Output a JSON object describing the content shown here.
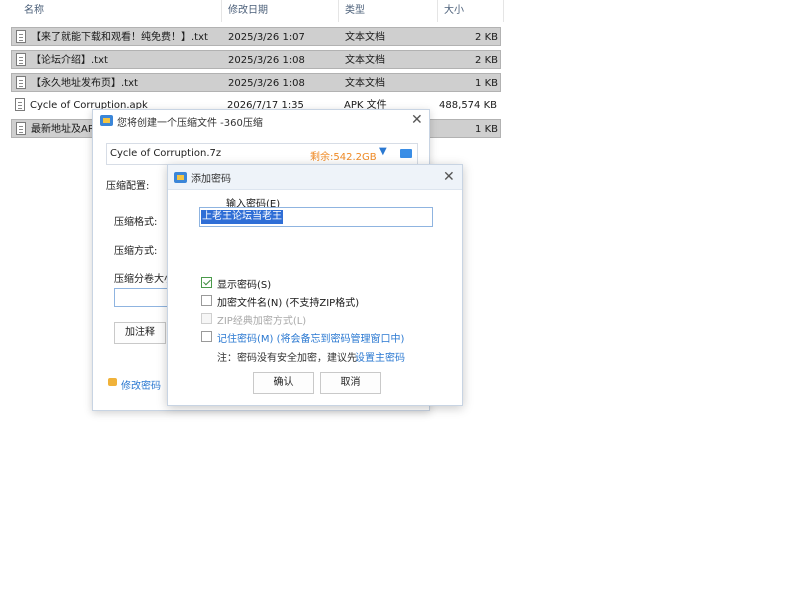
{
  "file_list": {
    "columns": {
      "name": "名称",
      "modified": "修改日期",
      "type": "类型",
      "size": "大小"
    },
    "rows": [
      {
        "name": "【来了就能下载和观看！纯免费！】.txt",
        "modified": "2025/3/26 1:07",
        "type": "文本文档",
        "size": "2 KB",
        "selected": true
      },
      {
        "name": "【论坛介绍】.txt",
        "modified": "2025/3/26 1:08",
        "type": "文本文档",
        "size": "2 KB",
        "selected": true
      },
      {
        "name": "【永久地址发布页】.txt",
        "modified": "2025/3/26 1:08",
        "type": "文本文档",
        "size": "1 KB",
        "selected": true
      },
      {
        "name": "Cycle of Corruption.apk",
        "modified": "2026/7/17 1:35",
        "type": "APK 文件",
        "size": "488,574 KB",
        "selected": false
      },
      {
        "name": "最新地址及AP",
        "modified": "",
        "type": "",
        "size": "1 KB",
        "selected": true
      }
    ]
  },
  "compress_dialog": {
    "title": "您将创建一个压缩文件 -360压缩",
    "filename": "Cycle of Corruption.7z",
    "free_space": "剩余:542.2GB",
    "config_label": "压缩配置:",
    "format_label": "压缩格式:",
    "method_label": "压缩方式:",
    "split_label": "压缩分卷大小",
    "comment_button": "加注释",
    "change_password": "修改密码"
  },
  "password_dialog": {
    "title": "添加密码",
    "enter_label": "输入密码(E)",
    "password_value": "上老王论坛当老王",
    "show_password": "显示密码(S)",
    "encrypt_names": "加密文件名(N) (不支持ZIP格式)",
    "zip_classic": "ZIP经典加密方式(L)",
    "remember": "记住密码(M) (将会备忘到密码管理窗口中)",
    "note_prefix": "注：密码没有安全加密，建议先",
    "note_link": "设置主密码",
    "ok": "确认",
    "cancel": "取消"
  }
}
